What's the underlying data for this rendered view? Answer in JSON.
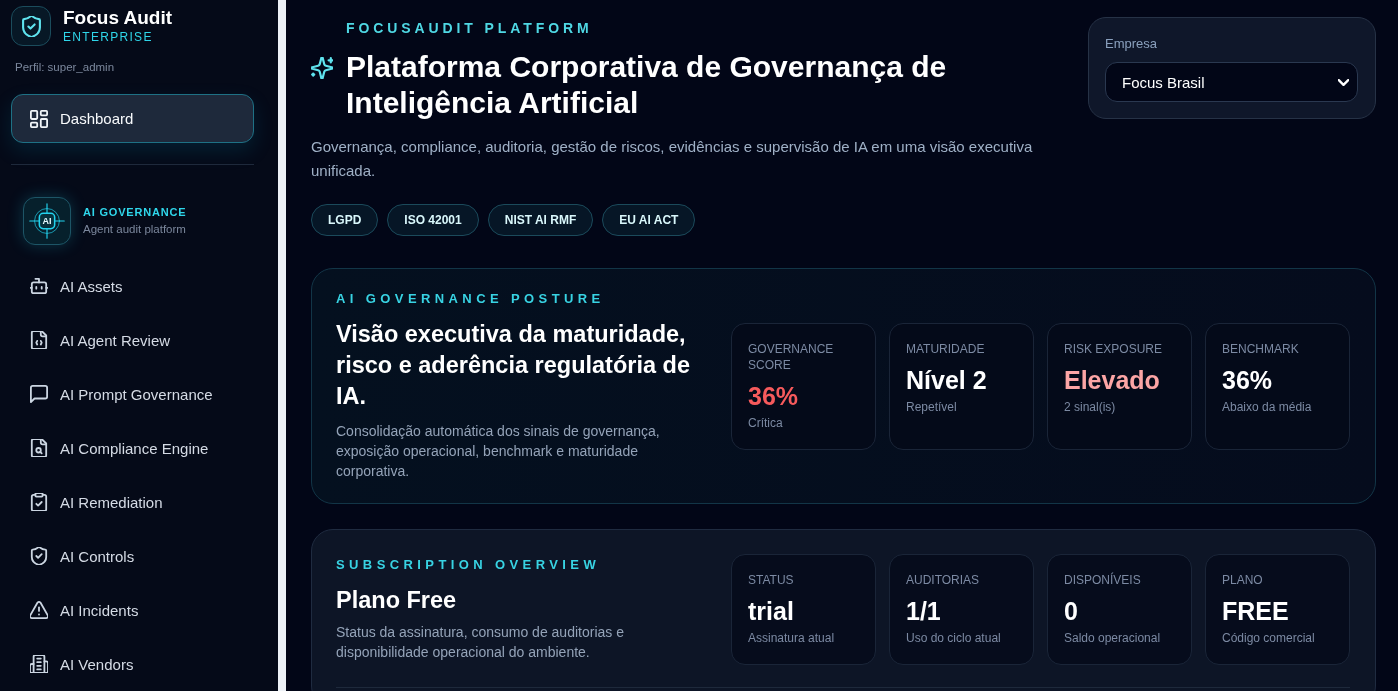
{
  "sidebar": {
    "brand": {
      "name": "Focus Audit",
      "edition": "ENTERPRISE"
    },
    "profile": "Perfil: super_admin",
    "primary_items": [
      {
        "label": "Dashboard",
        "selected": true
      }
    ],
    "section": {
      "badge": "AI",
      "title": "AI GOVERNANCE",
      "subtitle": "Agent audit platform",
      "items": [
        {
          "label": "AI Assets",
          "selected": false
        },
        {
          "label": "AI Agent Review",
          "selected": false
        },
        {
          "label": "AI Prompt Governance",
          "selected": false
        },
        {
          "label": "AI Compliance Engine",
          "selected": false
        },
        {
          "label": "AI Remediation",
          "selected": false
        },
        {
          "label": "AI Controls",
          "selected": false
        },
        {
          "label": "AI Incidents",
          "selected": false
        },
        {
          "label": "AI Vendors",
          "selected": false
        }
      ]
    }
  },
  "header": {
    "eyebrow": "FOCUSAUDIT PLATFORM",
    "title": "Plataforma Corporativa de Governança de Inteligência Artificial",
    "description": "Governança, compliance, auditoria, gestão de riscos, evidências e supervisão de IA em uma visão executiva unificada.",
    "tags": [
      "LGPD",
      "ISO 42001",
      "NIST AI RMF",
      "EU AI ACT"
    ]
  },
  "company_picker": {
    "label": "Empresa",
    "value": "Focus Brasil"
  },
  "posture": {
    "eyebrow": "AI GOVERNANCE POSTURE",
    "title": "Visão executiva da maturidade, risco e aderência regulatória de IA.",
    "description": "Consolidação automática dos sinais de governança, exposição operacional, benchmark e maturidade corporativa.",
    "metrics": [
      {
        "label": "GOVERNANCE SCORE",
        "value": "36%",
        "caption": "Crítica",
        "color": "#f65a5c"
      },
      {
        "label": "MATURIDADE",
        "value": "Nível 2",
        "caption": "Repetível",
        "color": "#ffffff"
      },
      {
        "label": "RISK EXPOSURE",
        "value": "Elevado",
        "caption": "2 sinal(is)",
        "color": "#fca5a5"
      },
      {
        "label": "BENCHMARK",
        "value": "36%",
        "caption": "Abaixo da média",
        "color": "#ffffff"
      }
    ]
  },
  "subscription": {
    "eyebrow": "SUBSCRIPTION OVERVIEW",
    "title": "Plano Free",
    "description": "Status da assinatura, consumo de auditorias e disponibilidade operacional do ambiente.",
    "metrics": [
      {
        "label": "STATUS",
        "value": "trial",
        "caption": "Assinatura atual"
      },
      {
        "label": "AUDITORIAS",
        "value": "1/1",
        "caption": "Uso do ciclo atual"
      },
      {
        "label": "DISPONÍVEIS",
        "value": "0",
        "caption": "Saldo operacional"
      },
      {
        "label": "PLANO",
        "value": "FREE",
        "caption": "Código comercial"
      }
    ]
  }
}
